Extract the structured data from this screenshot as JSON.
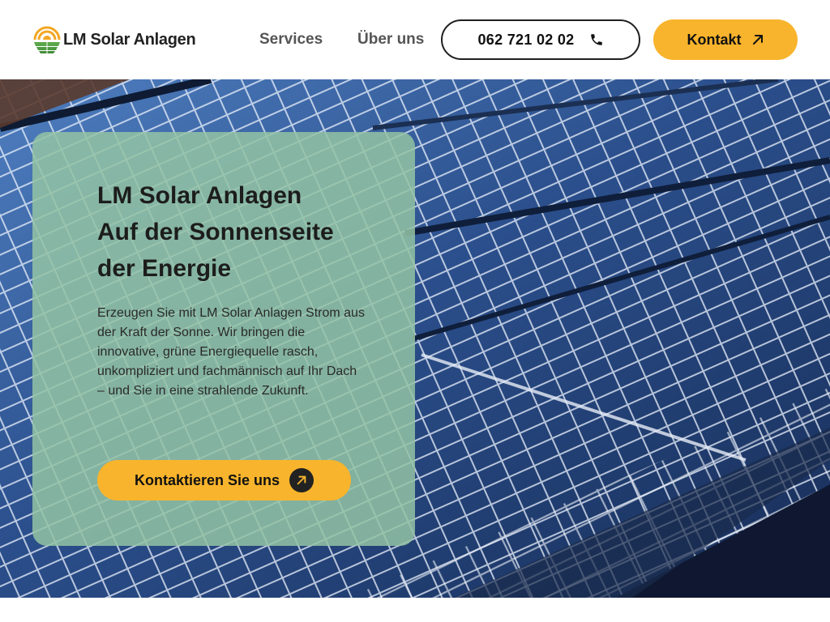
{
  "brand": {
    "name": "LM Solar Anlagen",
    "logo_icon": "sun-over-field-icon"
  },
  "nav": {
    "items": [
      {
        "label": "Services"
      },
      {
        "label": "Über uns"
      }
    ],
    "phone": {
      "label": "062 721 02 02",
      "icon": "phone-icon"
    },
    "contact": {
      "label": "Kontakt",
      "icon": "arrow-up-right-icon"
    }
  },
  "hero": {
    "background": "solar-panels-photo",
    "title_lines": [
      "LM Solar Anlagen",
      "Auf der Sonnenseite",
      "der Energie"
    ],
    "text": "Erzeugen Sie mit LM Solar Anlagen Strom aus der Kraft der Sonne. Wir bringen die innovative, grüne Energiequelle rasch, unkompliziert und fachmännisch auf Ihr Dach – und Sie in eine strahlende Zukunft.",
    "cta": {
      "label": "Kontaktieren Sie uns",
      "icon": "arrow-up-right-icon"
    }
  },
  "colors": {
    "accent": "#f8b42c",
    "card": "#93c2a4",
    "text": "#1d1d1d",
    "panel": "#1d3563"
  }
}
